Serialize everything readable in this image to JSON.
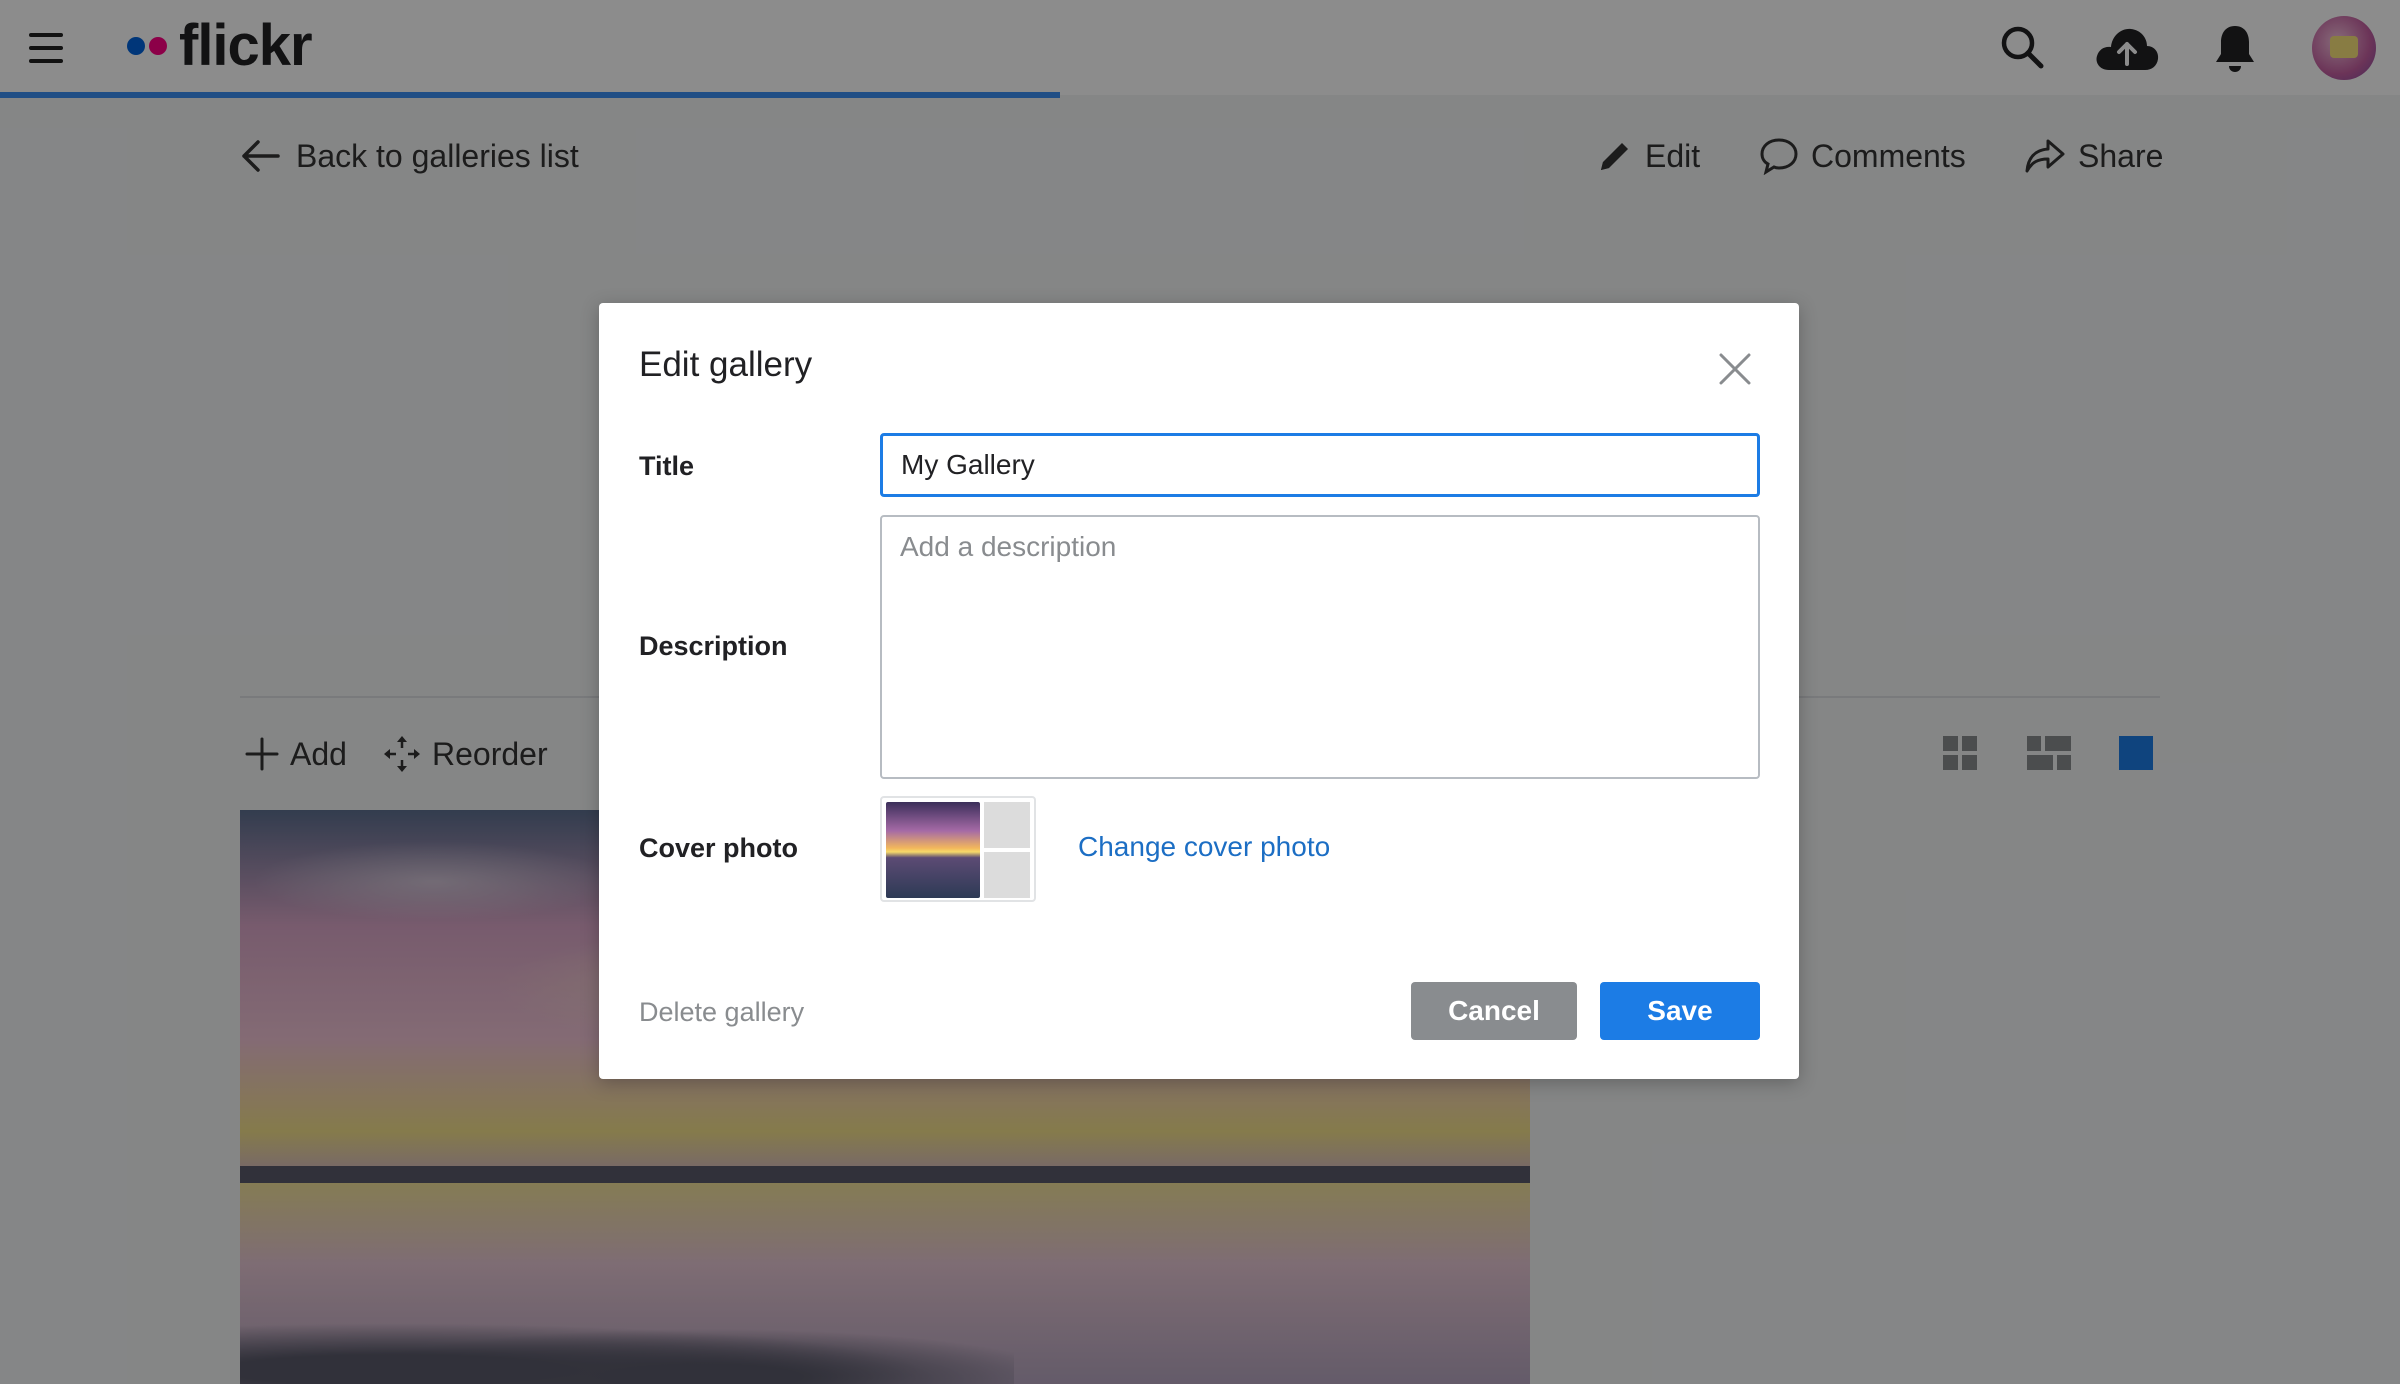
{
  "app": {
    "logo_text": "flickr"
  },
  "nav": {
    "icons": [
      "menu-icon",
      "search-icon",
      "upload-cloud-icon",
      "notifications-bell-icon"
    ],
    "progress_fraction": 0.44
  },
  "subheader": {
    "back_label": "Back to galleries list",
    "edit_label": "Edit",
    "comments_label": "Comments",
    "share_label": "Share"
  },
  "toolbar": {
    "add_label": "Add",
    "reorder_label": "Reorder",
    "layouts": [
      "grid-small-icon",
      "grid-justified-icon",
      "single-large-icon"
    ],
    "active_layout": "single-large-icon"
  },
  "modal": {
    "title": "Edit gallery",
    "title_label": "Title",
    "title_value": "My Gallery",
    "description_label": "Description",
    "description_placeholder": "Add a description",
    "description_value": "",
    "cover_label": "Cover photo",
    "change_cover_label": "Change cover photo",
    "delete_label": "Delete gallery",
    "cancel_label": "Cancel",
    "save_label": "Save"
  },
  "colors": {
    "accent": "#1c7ce5",
    "link": "#1c6ec4",
    "cancel_button": "#898c8f",
    "brand_blue_dot": "#0063dc",
    "brand_pink_dot": "#ff0084"
  }
}
